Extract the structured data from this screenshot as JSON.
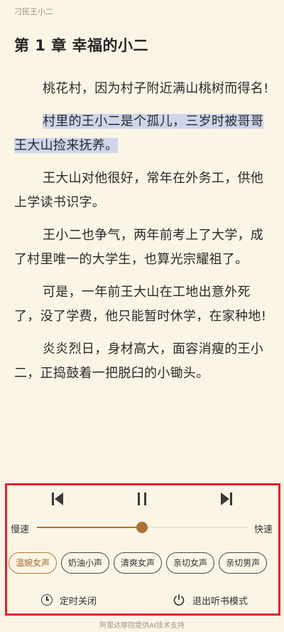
{
  "header": {
    "book_title": "刁民王小二"
  },
  "chapter": {
    "title": "第 1 章 幸福的小二"
  },
  "paragraphs": [
    {
      "text": "桃花村，因为村子附近满山桃树而得名!",
      "highlighted": false
    },
    {
      "text": "村里的王小二是个孤儿，三岁时被哥哥王大山捡来抚养。",
      "highlighted": true
    },
    {
      "text": "王大山对他很好，常年在外务工，供他上学读书识字。",
      "highlighted": false
    },
    {
      "text": "王小二也争气，两年前考上了大学，成了村里唯一的大学生，也算光宗耀祖了。",
      "highlighted": false
    },
    {
      "text": "可是，一年前王大山在工地出意外死了，没了学费，他只能暂时休学，在家种地!",
      "highlighted": false
    },
    {
      "text": "炎炎烈日，身材高大，面容消瘦的王小二，正捣鼓着一把脱臼的小锄头。",
      "highlighted": false
    }
  ],
  "player": {
    "prev_icon": "skip-previous-icon",
    "pause_icon": "pause-icon",
    "next_icon": "skip-next-icon",
    "speed_slow_label": "慢速",
    "speed_fast_label": "快速",
    "speed_level": 0.5,
    "voices": [
      "温婉女声",
      "奶油小声",
      "清爽女声",
      "亲切女声",
      "亲切男声"
    ],
    "selected_voice_index": 0,
    "timer_label": "定时关闭",
    "timer_icon": "clock-icon",
    "exit_label": "退出听书模式",
    "exit_icon": "power-icon"
  },
  "footer": {
    "note": "阿里达摩院提供AI技术支持"
  },
  "colors": {
    "page_background": "#fbf5e6",
    "highlight": "#cfd6ec",
    "accent": "#a8742f",
    "frame": "#e3202f"
  }
}
